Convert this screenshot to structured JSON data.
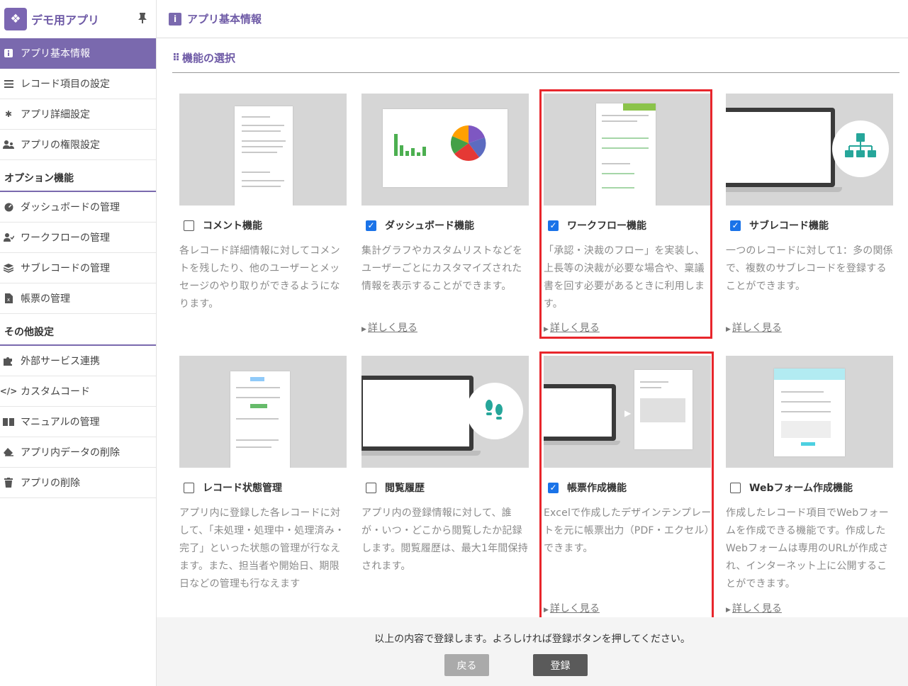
{
  "sidebar": {
    "app_name": "デモ用アプリ",
    "items": [
      {
        "label": "アプリ基本情報",
        "icon": "info-icon",
        "active": true
      },
      {
        "label": "レコード項目の設定",
        "icon": "list-icon"
      },
      {
        "label": "アプリ詳細設定",
        "icon": "gear-icon"
      },
      {
        "label": "アプリの権限設定",
        "icon": "users-icon"
      }
    ],
    "option_section": "オプション機能",
    "option_items": [
      {
        "label": "ダッシュボードの管理",
        "icon": "dashboard-icon"
      },
      {
        "label": "ワークフローの管理",
        "icon": "workflow-icon"
      },
      {
        "label": "サブレコードの管理",
        "icon": "layers-icon"
      },
      {
        "label": "帳票の管理",
        "icon": "document-icon"
      }
    ],
    "other_section": "その他設定",
    "other_items": [
      {
        "label": "外部サービス連携",
        "icon": "puzzle-icon"
      },
      {
        "label": "カスタムコード",
        "icon": "code-icon"
      },
      {
        "label": "マニュアルの管理",
        "icon": "book-icon"
      },
      {
        "label": "アプリ内データの削除",
        "icon": "eraser-icon"
      },
      {
        "label": "アプリの削除",
        "icon": "trash-icon"
      }
    ]
  },
  "header": {
    "title": "アプリ基本情報"
  },
  "main": {
    "section_title": "機能の選択",
    "more_label": "詳しく見る",
    "features": [
      {
        "label": "コメント機能",
        "checked": false,
        "desc": "各レコード詳細情報に対してコメントを残したり、他のユーザーとメッセージのやり取りができるようになります。",
        "has_more": false
      },
      {
        "label": "ダッシュボード機能",
        "checked": true,
        "desc": "集計グラフやカスタムリストなどをユーザーごとにカスタマイズされた情報を表示することができます。",
        "has_more": true
      },
      {
        "label": "ワークフロー機能",
        "checked": true,
        "desc": "「承認・決裁のフロー」を実装し、上長等の決裁が必要な場合や、稟議書を回す必要があるときに利用します。",
        "has_more": true
      },
      {
        "label": "サブレコード機能",
        "checked": true,
        "desc": "一つのレコードに対して1：多の関係で、複数のサブレコードを登録することができます。",
        "has_more": true
      },
      {
        "label": "レコード状態管理",
        "checked": false,
        "desc": "アプリ内に登録した各レコードに対して、「未処理・処理中・処理済み・完了」といった状態の管理が行なえます。また、担当者や開始日、期限日などの管理も行なえます",
        "has_more": false
      },
      {
        "label": "閲覧履歴",
        "checked": false,
        "desc": "アプリ内の登録情報に対して、誰が・いつ・どこから閲覧したか記録します。閲覧履歴は、最大1年間保持されます。",
        "has_more": false
      },
      {
        "label": "帳票作成機能",
        "checked": true,
        "desc": "Excelで作成したデザインテンプレートを元に帳票出力（PDF・エクセル）できます。",
        "has_more": true
      },
      {
        "label": "Webフォーム作成機能",
        "checked": false,
        "desc": "作成したレコード項目でWebフォームを作成できる機能です。作成したWebフォームは専用のURLが作成され、インターネット上に公開することができます。",
        "has_more": true
      }
    ]
  },
  "footer": {
    "message": "以上の内容で登録します。よろしければ登録ボタンを押してください。",
    "back_label": "戻る",
    "register_label": "登録"
  },
  "colors": {
    "accent": "#7a69ae",
    "highlight": "#e8262c",
    "checkbox": "#1a73e8"
  }
}
